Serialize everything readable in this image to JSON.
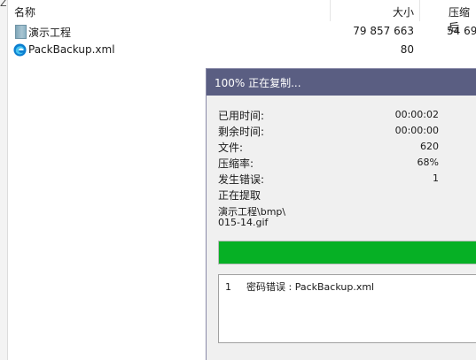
{
  "corner_char": "Z",
  "columns": {
    "name": "名称",
    "size": "大小",
    "packed": "压缩后"
  },
  "files": [
    {
      "name": "演示工程",
      "size": "79 857 663",
      "packed": "54 69",
      "icon": "folder-icon"
    },
    {
      "name": "PackBackup.xml",
      "size": "80",
      "packed": "",
      "icon": "edge-browser-icon"
    }
  ],
  "dialog": {
    "title": "100% 正在复制...",
    "elapsed_label": "已用时间:",
    "elapsed_value": "00:00:02",
    "remaining_label": "剩余时间:",
    "remaining_value": "00:00:00",
    "files_label": "文件:",
    "files_value": "620",
    "ratio_label": "压缩率:",
    "ratio_value": "68%",
    "errors_label": "发生错误:",
    "errors_value": "1",
    "status": "正在提取",
    "path_line1": "演示工程\\bmp\\",
    "path_line2": "015-14.gif",
    "progress": 1.0,
    "messages": [
      {
        "num": "1",
        "text": "密码错误 : PackBackup.xml"
      }
    ],
    "cut_marks": [
      "",
      "",
      "",
      "",
      ""
    ]
  },
  "colors": {
    "title_bar": "#5a5e82",
    "progress_fill": "#06b025"
  }
}
